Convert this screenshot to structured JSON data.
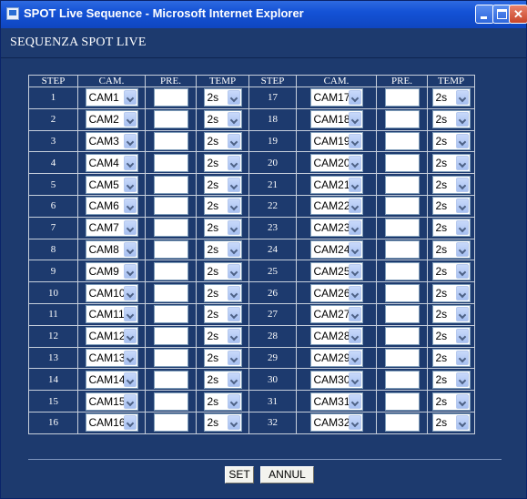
{
  "window": {
    "title": "SPOT Live Sequence - Microsoft Internet Explorer"
  },
  "page": {
    "heading": "SEQUENZA SPOT LIVE"
  },
  "table": {
    "headers": [
      "STEP",
      "CAM.",
      "PRE.",
      "TEMP",
      "STEP",
      "CAM.",
      "PRE.",
      "TEMP"
    ],
    "rows": [
      {
        "step_a": "1",
        "cam_a": "CAM1",
        "pre_a": "",
        "temp_a": "2s",
        "step_b": "17",
        "cam_b": "CAM17",
        "pre_b": "",
        "temp_b": "2s"
      },
      {
        "step_a": "2",
        "cam_a": "CAM2",
        "pre_a": "",
        "temp_a": "2s",
        "step_b": "18",
        "cam_b": "CAM18",
        "pre_b": "",
        "temp_b": "2s"
      },
      {
        "step_a": "3",
        "cam_a": "CAM3",
        "pre_a": "",
        "temp_a": "2s",
        "step_b": "19",
        "cam_b": "CAM19",
        "pre_b": "",
        "temp_b": "2s"
      },
      {
        "step_a": "4",
        "cam_a": "CAM4",
        "pre_a": "",
        "temp_a": "2s",
        "step_b": "20",
        "cam_b": "CAM20",
        "pre_b": "",
        "temp_b": "2s"
      },
      {
        "step_a": "5",
        "cam_a": "CAM5",
        "pre_a": "",
        "temp_a": "2s",
        "step_b": "21",
        "cam_b": "CAM21",
        "pre_b": "",
        "temp_b": "2s"
      },
      {
        "step_a": "6",
        "cam_a": "CAM6",
        "pre_a": "",
        "temp_a": "2s",
        "step_b": "22",
        "cam_b": "CAM22",
        "pre_b": "",
        "temp_b": "2s"
      },
      {
        "step_a": "7",
        "cam_a": "CAM7",
        "pre_a": "",
        "temp_a": "2s",
        "step_b": "23",
        "cam_b": "CAM23",
        "pre_b": "",
        "temp_b": "2s"
      },
      {
        "step_a": "8",
        "cam_a": "CAM8",
        "pre_a": "",
        "temp_a": "2s",
        "step_b": "24",
        "cam_b": "CAM24",
        "pre_b": "",
        "temp_b": "2s"
      },
      {
        "step_a": "9",
        "cam_a": "CAM9",
        "pre_a": "",
        "temp_a": "2s",
        "step_b": "25",
        "cam_b": "CAM25",
        "pre_b": "",
        "temp_b": "2s"
      },
      {
        "step_a": "10",
        "cam_a": "CAM10",
        "pre_a": "",
        "temp_a": "2s",
        "step_b": "26",
        "cam_b": "CAM26",
        "pre_b": "",
        "temp_b": "2s"
      },
      {
        "step_a": "11",
        "cam_a": "CAM11",
        "pre_a": "",
        "temp_a": "2s",
        "step_b": "27",
        "cam_b": "CAM27",
        "pre_b": "",
        "temp_b": "2s"
      },
      {
        "step_a": "12",
        "cam_a": "CAM12",
        "pre_a": "",
        "temp_a": "2s",
        "step_b": "28",
        "cam_b": "CAM28",
        "pre_b": "",
        "temp_b": "2s"
      },
      {
        "step_a": "13",
        "cam_a": "CAM13",
        "pre_a": "",
        "temp_a": "2s",
        "step_b": "29",
        "cam_b": "CAM29",
        "pre_b": "",
        "temp_b": "2s"
      },
      {
        "step_a": "14",
        "cam_a": "CAM14",
        "pre_a": "",
        "temp_a": "2s",
        "step_b": "30",
        "cam_b": "CAM30",
        "pre_b": "",
        "temp_b": "2s"
      },
      {
        "step_a": "15",
        "cam_a": "CAM15",
        "pre_a": "",
        "temp_a": "2s",
        "step_b": "31",
        "cam_b": "CAM31",
        "pre_b": "",
        "temp_b": "2s"
      },
      {
        "step_a": "16",
        "cam_a": "CAM16",
        "pre_a": "",
        "temp_a": "2s",
        "step_b": "32",
        "cam_b": "CAM32",
        "pre_b": "",
        "temp_b": "2s"
      }
    ]
  },
  "buttons": {
    "set": "SET",
    "annul": "ANNUL"
  },
  "icons": {
    "window_icon": "ie-page-icon",
    "minimize": "minimize-icon",
    "maximize": "maximize-icon",
    "close": "close-icon",
    "dropdown": "chevron-down-icon"
  },
  "colors": {
    "background": "#1d3a6e",
    "titlebar": "#1452d6",
    "grid_lines": "#c7cfdc",
    "text": "#ffffff"
  }
}
